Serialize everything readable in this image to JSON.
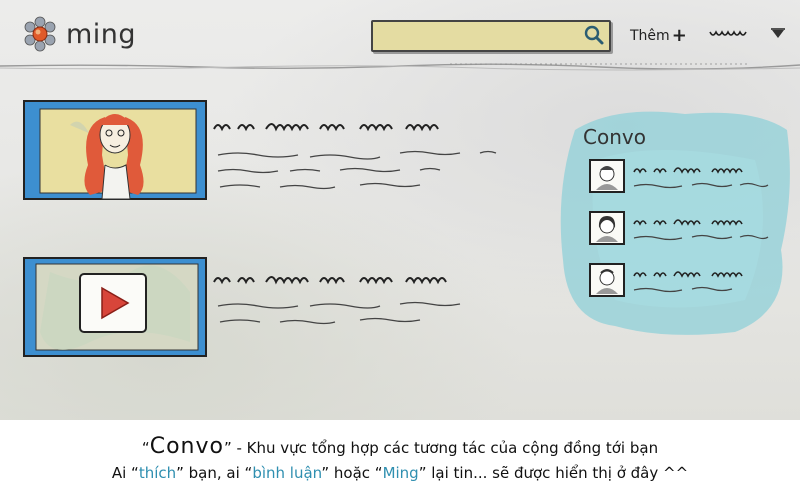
{
  "header": {
    "logo_text": "ming",
    "search": {
      "value": "",
      "placeholder": ""
    },
    "add_label": "Thêm",
    "add_symbol": "+"
  },
  "sidebar_panel": {
    "title": "Convo",
    "items": [
      {
        "avatar": "person-avatar"
      },
      {
        "avatar": "person-avatar"
      },
      {
        "avatar": "person-avatar"
      }
    ]
  },
  "feed": {
    "posts": [
      {
        "media": "photo-person"
      },
      {
        "media": "video-play"
      }
    ]
  },
  "caption": {
    "line1_quote_open": "“",
    "line1_word": "Convo",
    "line1_quote_close": "”",
    "line1_rest": " - Khu vực tổng hợp các tương tác của cộng đồng tới bạn",
    "line2_a": "Ai “",
    "line2_thich": "thích",
    "line2_b": "” bạn, ai “",
    "line2_binhluan": "bình luận",
    "line2_c": "” hoặc “",
    "line2_ming": "Ming",
    "line2_d": "” lại tin... sẽ được hiển thị ở đây ^^"
  },
  "colors": {
    "accent_blue": "#2f8fb0",
    "search_fill": "#e4dca2",
    "photo_frame": "#3d8fd0",
    "teal_panel": "#8fd0d8"
  }
}
